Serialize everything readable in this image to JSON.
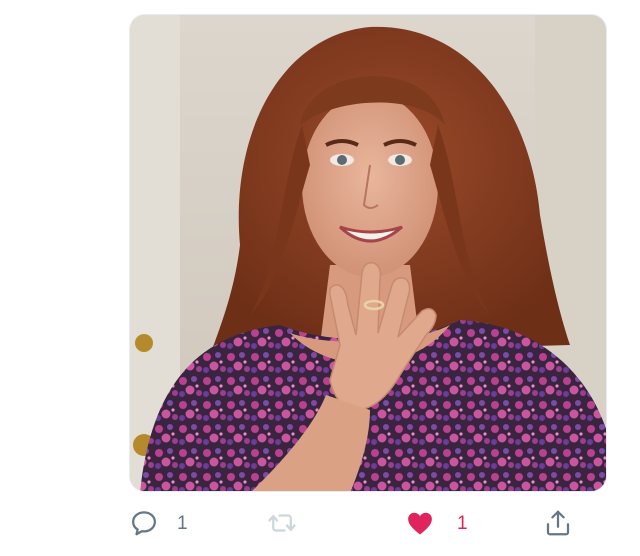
{
  "media": {
    "alt": "",
    "icon": "photo"
  },
  "actions": {
    "reply": {
      "icon": "reply-icon",
      "count": "1"
    },
    "retweet": {
      "icon": "retweet-icon",
      "count": ""
    },
    "like": {
      "icon": "heart-icon",
      "count": "1",
      "liked": true,
      "color": "#e0245e"
    },
    "share": {
      "icon": "share-icon",
      "count": ""
    }
  },
  "colors": {
    "icon_gray": "#657786",
    "retweet_disabled": "#ccd6dd",
    "like_red": "#e0245e"
  }
}
